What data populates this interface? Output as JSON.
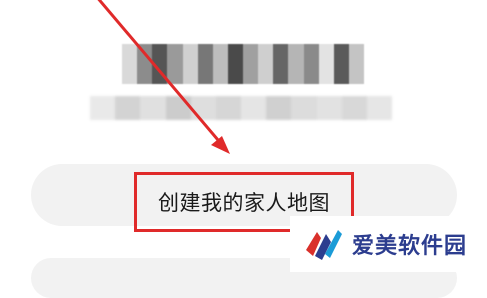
{
  "blurred_title_colors": [
    "#d9d9d9",
    "#8c8c8c",
    "#555555",
    "#9a9a9a",
    "#d0d0d0",
    "#777777",
    "#bdbdbd",
    "#4a4a4a",
    "#a0a0a0",
    "#cfcfcf",
    "#666666",
    "#b5b5b5",
    "#8a8a8a",
    "#e3e3e3",
    "#5a5a5a",
    "#c4c4c4"
  ],
  "blurred_sub_colors": [
    "#e9e9e9",
    "#d3d3d3",
    "#e0e0e0",
    "#cccccc",
    "#dedede",
    "#d6d6d6",
    "#e5e5e5",
    "#d0d0d0",
    "#dcdcdc",
    "#e2e2e2",
    "#d8d8d8",
    "#e6e6e6"
  ],
  "action": {
    "label": "创建我的家人地图"
  },
  "annotation": {
    "highlight_color": "#e02a2a"
  },
  "watermark": {
    "text": "爱美软件园",
    "logo_icon": "aimei-logo-icon",
    "text_color": "#2c3d8f"
  }
}
